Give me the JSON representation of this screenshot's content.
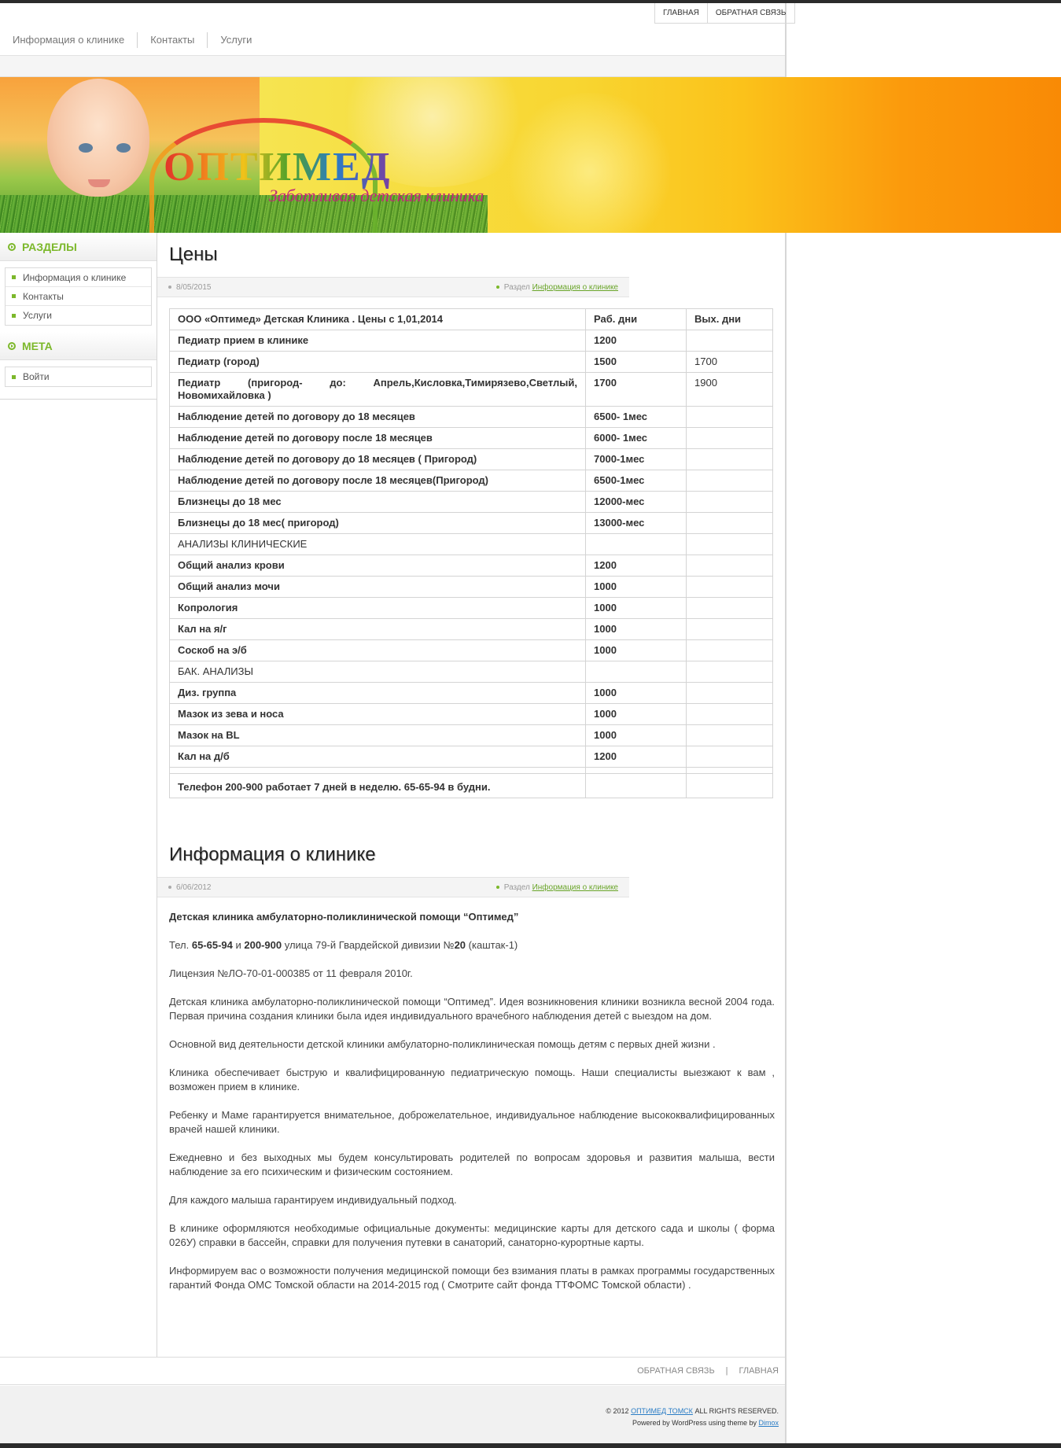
{
  "top_links": [
    "Главная",
    "Обратная связь"
  ],
  "nav": [
    "Информация о клинике",
    "Контакты",
    "Услуги"
  ],
  "header": {
    "logo": "ОПТИМЕД",
    "tagline": "Заботливая детская клиника"
  },
  "sidebar": {
    "sections_title": "Разделы",
    "sections": [
      "Информация о клинике",
      "Контакты",
      "Услуги"
    ],
    "meta_title": "Мета",
    "meta": [
      "Войти"
    ]
  },
  "post1": {
    "title": "Цены",
    "date": "8/05/2015",
    "category_prefix": "Раздел",
    "category": "Информация о клинике"
  },
  "prices": [
    [
      "ООО «Оптимед» Детская Клиника . Цены с 1,01,2014",
      "Раб. дни",
      "Вых. дни"
    ],
    [
      "Педиатр прием в клинике",
      "1200",
      ""
    ],
    [
      "Педиатр (город)",
      "1500",
      "1700"
    ],
    [
      "Педиатр (пригород- до: Апрель,Кисловка,Тимирязево,Светлый, Новомихайловка )",
      "1700",
      "1900"
    ],
    [
      "Наблюдение детей по договору до 18 месяцев",
      "6500- 1мес",
      ""
    ],
    [
      "Наблюдение детей по договору  после 18 месяцев",
      "6000- 1мес",
      ""
    ],
    [
      "Наблюдение детей по договору до 18 месяцев ( Пригород)",
      "7000-1мес",
      ""
    ],
    [
      "Наблюдение детей по договору  после 18 месяцев(Пригород)",
      "6500-1мес",
      ""
    ],
    [
      "Близнецы до 18 мес",
      "12000-мес",
      ""
    ],
    [
      "Близнецы до 18 мес( пригород)",
      "13000-мес",
      ""
    ],
    [
      "АНАЛИЗЫ КЛИНИЧЕСКИЕ",
      "",
      ""
    ],
    [
      "Общий анализ крови",
      "1200",
      ""
    ],
    [
      "Общий анализ мочи",
      "1000",
      ""
    ],
    [
      "Копрология",
      "1000",
      ""
    ],
    [
      "Кал на я/г",
      "1000",
      ""
    ],
    [
      "Соскоб на э/б",
      "1000",
      ""
    ],
    [
      "БАК. АНАЛИЗЫ",
      "",
      ""
    ],
    [
      "Диз. группа",
      "1000",
      ""
    ],
    [
      "Мазок из зева и носа",
      "1000",
      ""
    ],
    [
      "Мазок на BL",
      "1000",
      ""
    ],
    [
      "Кал на д/б",
      "1200",
      ""
    ],
    [
      "",
      "",
      ""
    ],
    [
      "Телефон 200-900  работает 7 дней в неделю.  65-65-94 в будни.",
      "",
      ""
    ]
  ],
  "post2": {
    "title": "Информация о клинике",
    "date": "6/06/2012",
    "category_prefix": "Раздел",
    "category": "Информация о клинике",
    "lead": "Детская клиника  амбулаторно-поликлинической помощи “Оптимед”",
    "tel_prefix": "Тел.",
    "tel1": "65-65-94",
    "tel_and": "и",
    "tel2": "200-900",
    "address": "улица 79-й Гвардейской дивизии №",
    "house": "20",
    "address_tail": "(каштак-1)",
    "license": "Лицензия №ЛО-70-01-000385 от 11 февраля 2010г.",
    "paragraphs": [
      "Детская клиника амбулаторно-поликлинической помощи “Оптимед”.   Идея возникновения клиники возникла весной 2004 года. Первая причина создания клиники была идея индивидуального врачебного наблюдения детей с выездом на дом.",
      "Основной вид деятельности детской клиники амбулаторно-поликлиническая помощь детям с первых дней жизни .",
      "Клиника   обеспечивает   быструю и квалифицированную педиатрическую помощь. Наши специалисты выезжают к вам , возможен прием в клинике.",
      "Ребенку и Маме гарантируется внимательное, доброжелательное, индивидуальное наблюдение высококвалифицированных врачей  нашей клиники.",
      "Ежедневно и без выходных мы будем консультировать   родителей по вопросам здоровья и развития малыша, вести наблюдение за его психическим и физическим  состоянием.",
      "Для каждого малыша гарантируем индивидуальный подход.",
      "В   клинике оформляются необходимые официальные документы: медицинские карты для детского сада и школы ( форма 026У) справки в бассейн, справки для получения путевки в санаторий, санаторно-курортные карты.",
      "Информируем вас о возможности получения медицинской помощи без взимания платы в рамках программы государственных гарантий Фонда ОМС Томской области на 2014-2015 год ( Смотрите сайт фонда ТТФОМС Томской области) ."
    ]
  },
  "footer": {
    "links": [
      "Обратная связь",
      "Главная"
    ],
    "separator": "|",
    "copyright_prefix": "© 2012",
    "copyright_link": "ОПТИМЕД ТОМСК",
    "copyright_suffix": "ALL RIGHTS RESERVED.",
    "powered": "Powered by WordPress using theme by",
    "powered_link": "Dimox"
  },
  "colors": {
    "accent": "#7cb82b",
    "link_blue": "#2b7dc5",
    "header_orange": "#f98a05"
  }
}
